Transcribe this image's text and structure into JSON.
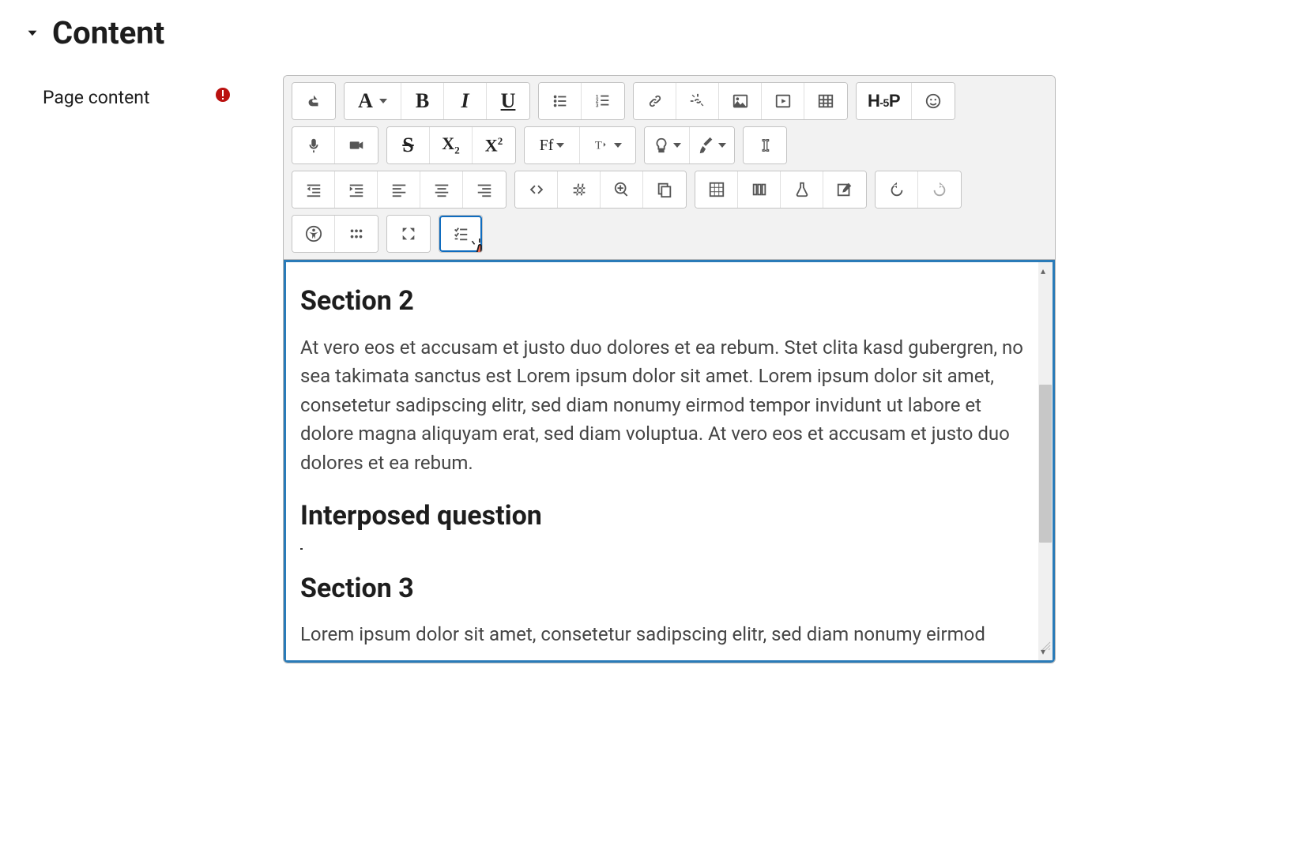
{
  "section": {
    "title": "Content",
    "field_label": "Page content"
  },
  "editor": {
    "content": [
      {
        "type": "h2",
        "text": "Section 2"
      },
      {
        "type": "p",
        "text": "At vero eos et accusam et justo duo dolores et ea rebum. Stet clita kasd gubergren, no sea takimata sanctus est Lorem ipsum dolor sit amet. Lorem ipsum dolor sit amet, consetetur sadipscing elitr, sed diam nonumy eirmod tempor invidunt ut labore et dolore magna aliquyam erat, sed diam voluptua. At vero eos et accusam et justo duo dolores et ea rebum."
      },
      {
        "type": "h2",
        "text": "Interposed question"
      },
      {
        "type": "cursor"
      },
      {
        "type": "h2",
        "text": "Section 3"
      },
      {
        "type": "p",
        "text": "Lorem ipsum dolor sit amet, consetetur sadipscing elitr, sed diam nonumy eirmod"
      }
    ]
  },
  "toolbar": {
    "row1": {
      "toggle": "↧",
      "paragraph_style": "A",
      "bold": "B",
      "italic": "I",
      "underline": "U",
      "h5p": "H-P",
      "groups": [
        "ul-list",
        "ol-list",
        "link",
        "unlink",
        "image",
        "video",
        "table",
        "emoji"
      ]
    },
    "row2": {
      "strike": "S",
      "subscript": "X₂",
      "superscript": "X²",
      "font_family": "Ff",
      "button_names": [
        "microphone",
        "camera",
        "strikethrough",
        "subscript",
        "superscript",
        "font-family",
        "text-direction",
        "idea",
        "paint-brush",
        "text-cursor"
      ]
    },
    "row3": {
      "button_names": [
        "indent-left",
        "indent-right",
        "align-left",
        "align-center",
        "align-right",
        "code",
        "hash",
        "zoom-in",
        "copy",
        "grid",
        "layout",
        "flask",
        "compose",
        "undo",
        "redo"
      ]
    },
    "row4": {
      "button_names": [
        "accessibility",
        "braille",
        "expand",
        "checklist"
      ]
    }
  }
}
